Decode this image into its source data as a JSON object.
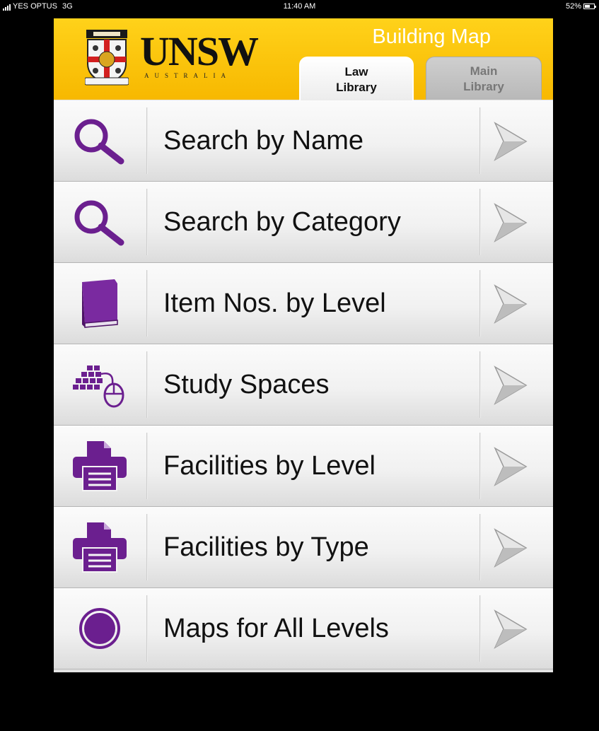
{
  "status_bar": {
    "carrier": "YES OPTUS",
    "network": "3G",
    "time": "11:40 AM",
    "battery": "52%",
    "battery_level": 0.52
  },
  "header": {
    "logo_text": "UNSW",
    "logo_subtext": "AUSTRALIA",
    "title": "Building Map"
  },
  "tabs": [
    {
      "line1": "Law",
      "line2": "Library",
      "active": true
    },
    {
      "line1": "Main",
      "line2": "Library",
      "active": false
    }
  ],
  "menu": [
    {
      "label": "Search by Name",
      "icon": "search-icon"
    },
    {
      "label": "Search by Category",
      "icon": "search-icon"
    },
    {
      "label": "Item Nos. by Level",
      "icon": "book-icon"
    },
    {
      "label": "Study Spaces",
      "icon": "keyboard-mouse-icon"
    },
    {
      "label": "Facilities by Level",
      "icon": "printer-icon"
    },
    {
      "label": "Facilities by Type",
      "icon": "printer-icon"
    },
    {
      "label": "Maps for All Levels",
      "icon": "circle-icon"
    }
  ],
  "colors": {
    "header_yellow": "#ffcc00",
    "icon_purple": "#6b1f8f",
    "background": "#000000"
  }
}
